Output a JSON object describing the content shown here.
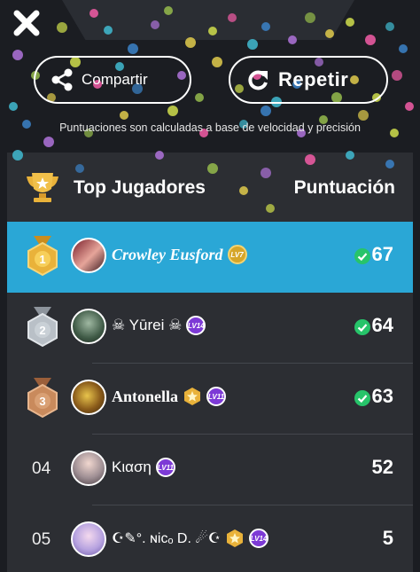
{
  "actions": {
    "share_label": "Compartir",
    "repeat_label": "Repetir"
  },
  "note": "Puntuaciones son calculadas a base de velocidad y precisión",
  "board": {
    "title": "Top Jugadores",
    "score_header": "Puntuación"
  },
  "players": [
    {
      "rank": "1",
      "name": "Crowley Eusford",
      "level": "LV7",
      "score": "67",
      "verified": true
    },
    {
      "rank": "2",
      "name": "☠ Yūrei ☠",
      "level": "LV14",
      "score": "64",
      "verified": true
    },
    {
      "rank": "3",
      "name": "Antonella",
      "level": "LV11",
      "score": "63",
      "verified": true
    },
    {
      "rank": "04",
      "name": "Kιαση",
      "level": "LV11",
      "score": "52",
      "verified": false
    },
    {
      "rank": "05",
      "name": "☪✎°. ɴicₒ D. ☄☪",
      "level": "LV14",
      "score": "5",
      "verified": false
    }
  ],
  "colors": {
    "highlight": "#2aa7d6",
    "background": "#1b1d22",
    "panel": "#2c2e33",
    "verified": "#27c46a",
    "level_badge": "#7d3ad6",
    "gold": "#e9b23a"
  }
}
